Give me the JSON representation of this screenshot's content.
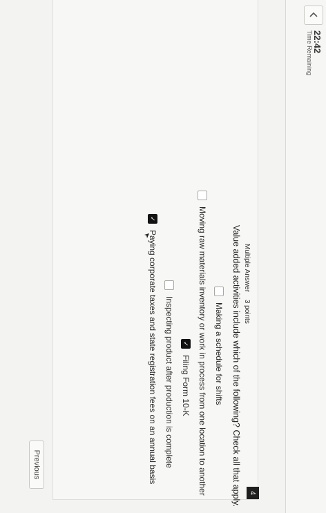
{
  "header": {
    "back_icon": "chevron-left-icon",
    "timer_value": "22:42",
    "timer_label": "Time Remaining"
  },
  "question": {
    "number": "4",
    "type": "Multiple Answer",
    "points": "3 points",
    "prompt": "Value added activities include which of the following? Check all that apply.",
    "options": [
      {
        "label": "Making a schedule for shifts",
        "checked": false
      },
      {
        "label": "Moving raw materials inventory or work in process from one location to another",
        "checked": false
      },
      {
        "label": "Filing Form 10-K",
        "checked": true
      },
      {
        "label": "Inspecting product after production is complete",
        "checked": false
      },
      {
        "label": "Paying corporate taxes and state registration fees on an annual basis",
        "checked": true
      }
    ]
  },
  "footer": {
    "previous_label": "Previous"
  },
  "colors": {
    "page_bg": "#f1f1ef",
    "checked_box": "#121212",
    "question_number_bg": "#1f1f1f"
  }
}
